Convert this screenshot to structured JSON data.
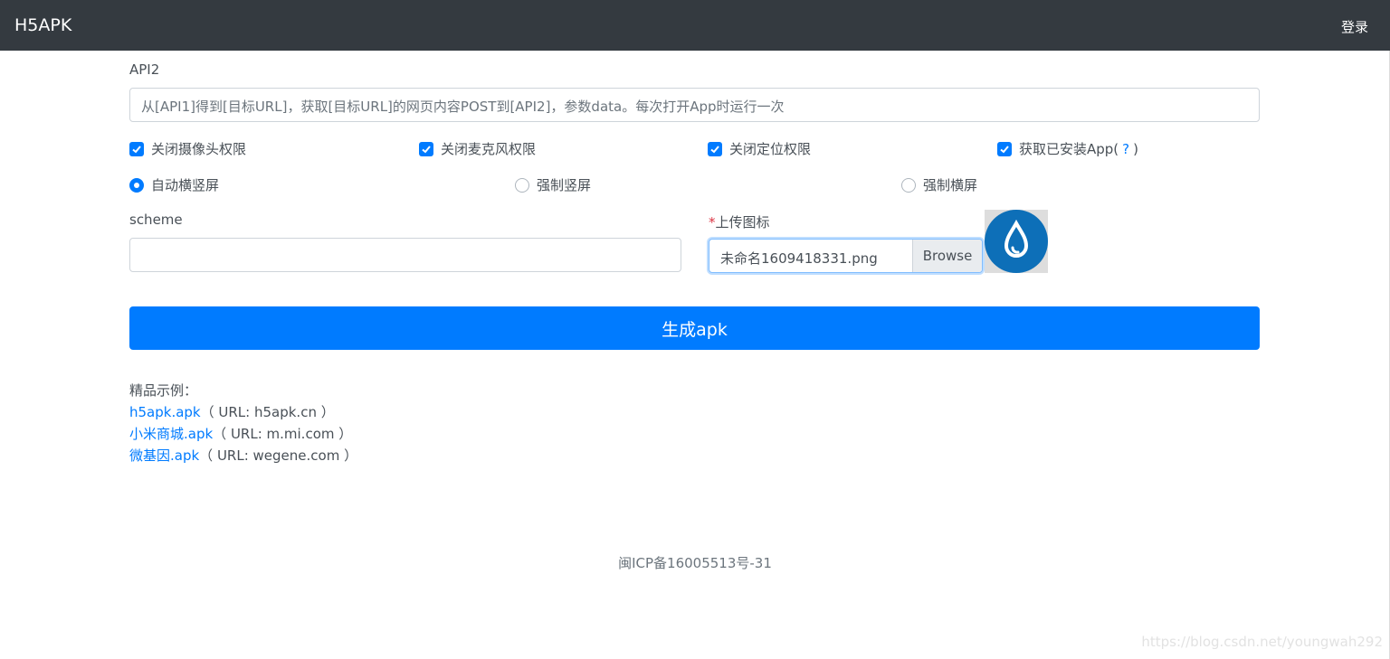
{
  "navbar": {
    "brand": "H5APK",
    "login": "登录"
  },
  "api2": {
    "label": "API2",
    "placeholder": "从[API1]得到[目标URL]，获取[目标URL]的网页内容POST到[API2]，参数data。每次打开App时运行一次"
  },
  "permissions": [
    {
      "label": "关闭摄像头权限",
      "checked": true
    },
    {
      "label": "关闭麦克风权限",
      "checked": true
    },
    {
      "label": "关闭定位权限",
      "checked": true
    },
    {
      "label": "获取已安装App(",
      "help": "?",
      "suffix": ")",
      "checked": true
    }
  ],
  "orientation": {
    "options": [
      "自动横竖屏",
      "强制竖屏",
      "强制横屏"
    ],
    "selected": "自动横竖屏"
  },
  "scheme": {
    "label": "scheme",
    "value": ""
  },
  "upload": {
    "required_mark": "*",
    "label": "上传图标",
    "file_name": "未命名1609418331.png",
    "browse": "Browse"
  },
  "generate_button": "生成apk",
  "examples": {
    "title": "精品示例：",
    "items": [
      {
        "name": "h5apk.apk",
        "url": "（ URL: h5apk.cn ）"
      },
      {
        "name": "小米商城.apk",
        "url": "（ URL: m.mi.com ）"
      },
      {
        "name": "微基因.apk",
        "url": "（ URL: wegene.com ）"
      }
    ]
  },
  "footer": "闽ICP备16005513号-31",
  "watermark": "https://blog.csdn.net/youngwah292",
  "colors": {
    "navbar": "#343a40",
    "primary": "#007bff",
    "icon_blue": "#0d6fb8"
  }
}
